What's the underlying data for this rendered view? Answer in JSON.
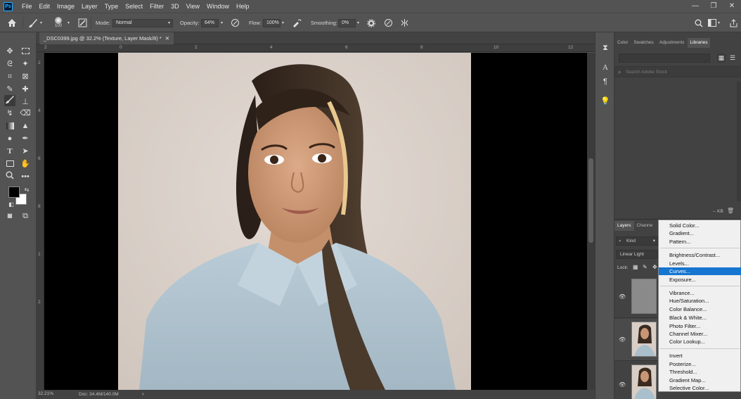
{
  "menubar": {
    "logo": "Ps",
    "items": [
      "File",
      "Edit",
      "Image",
      "Layer",
      "Type",
      "Select",
      "Filter",
      "3D",
      "View",
      "Window",
      "Help"
    ],
    "window_controls": [
      "—",
      "❐",
      "✕"
    ]
  },
  "options": {
    "brush_size": "100",
    "mode_label": "Mode:",
    "mode_value": "Normal",
    "opacity_label": "Opacity:",
    "opacity_value": "64%",
    "flow_label": "Flow:",
    "flow_value": "100%",
    "smoothing_label": "Smoothing:",
    "smoothing_value": "0%"
  },
  "document": {
    "tab_title": "_DSC0399.jpg @ 32.2% (Texture, Layer Mask/8) *",
    "close": "✕",
    "ruler_h": [
      "2",
      "0",
      "2",
      "4",
      "6",
      "8",
      "10",
      "12"
    ],
    "ruler_v": [
      "2",
      "4",
      "6",
      "8",
      "1",
      "2"
    ],
    "zoom": "32.21%",
    "doc_info": "Doc: 34.4M/140.0M"
  },
  "right_panel": {
    "tabs": [
      "Color",
      "Swatches",
      "Adjustments",
      "Libraries"
    ],
    "search_placeholder": "Search Adobe Stock",
    "kb_label": "-- KB"
  },
  "layers_panel": {
    "tabs": [
      "Layers",
      "Channe"
    ],
    "kind_label": "Kind",
    "blend_mode": "Linear Light",
    "lock_label": "Lock:"
  },
  "adjustment_menu": {
    "items": [
      {
        "label": "Solid Color...",
        "highlighted": false
      },
      {
        "label": "Gradient...",
        "highlighted": false
      },
      {
        "label": "Pattern...",
        "highlighted": false
      },
      {
        "label": "Brightness/Contrast...",
        "highlighted": false
      },
      {
        "label": "Levels...",
        "highlighted": false
      },
      {
        "label": "Curves...",
        "highlighted": true
      },
      {
        "label": "Exposure...",
        "highlighted": false
      },
      {
        "label": "Vibrance...",
        "highlighted": false
      },
      {
        "label": "Hue/Saturation...",
        "highlighted": false
      },
      {
        "label": "Color Balance...",
        "highlighted": false
      },
      {
        "label": "Black & White...",
        "highlighted": false
      },
      {
        "label": "Photo Filter...",
        "highlighted": false
      },
      {
        "label": "Channel Mixer...",
        "highlighted": false
      },
      {
        "label": "Color Lookup...",
        "highlighted": false
      },
      {
        "label": "Invert",
        "highlighted": false
      },
      {
        "label": "Posterize...",
        "highlighted": false
      },
      {
        "label": "Threshold...",
        "highlighted": false
      },
      {
        "label": "Gradient Map...",
        "highlighted": false
      },
      {
        "label": "Selective Color...",
        "highlighted": false
      }
    ],
    "highlight_color": "#1675d1"
  },
  "colors": {
    "ui_bg": "#535353",
    "panel_bg": "#424242",
    "photo_bg": "#d8cec6"
  }
}
